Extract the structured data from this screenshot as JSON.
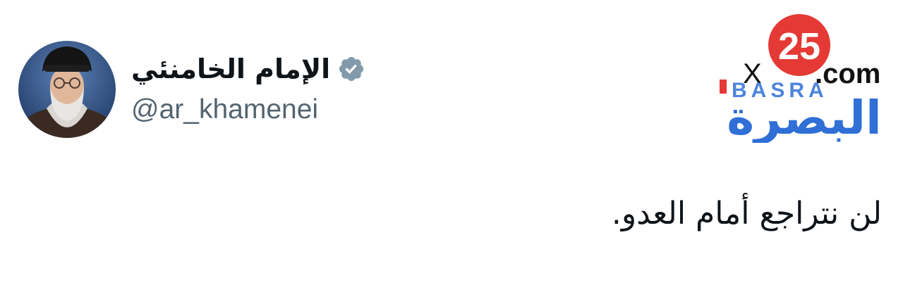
{
  "profile": {
    "display_name": "الإمام الخامنئي",
    "handle": "@ar_khamenei",
    "verified": true,
    "avatar_icon": "portrait-avatar",
    "verified_icon": "verified-badge-icon"
  },
  "tweet": {
    "text": "لن نتراجع أمام العدو."
  },
  "watermark": {
    "number": "25",
    "site": ".com",
    "brand_latin": "BASRA",
    "brand_arabic": "البصرة",
    "colors": {
      "red": "#e53935",
      "blue": "#2f6fd6",
      "black": "#111111"
    }
  },
  "colors": {
    "text_primary": "#0f1419",
    "text_secondary": "#536471",
    "verified_badge": "#829aab",
    "background": "#ffffff"
  }
}
